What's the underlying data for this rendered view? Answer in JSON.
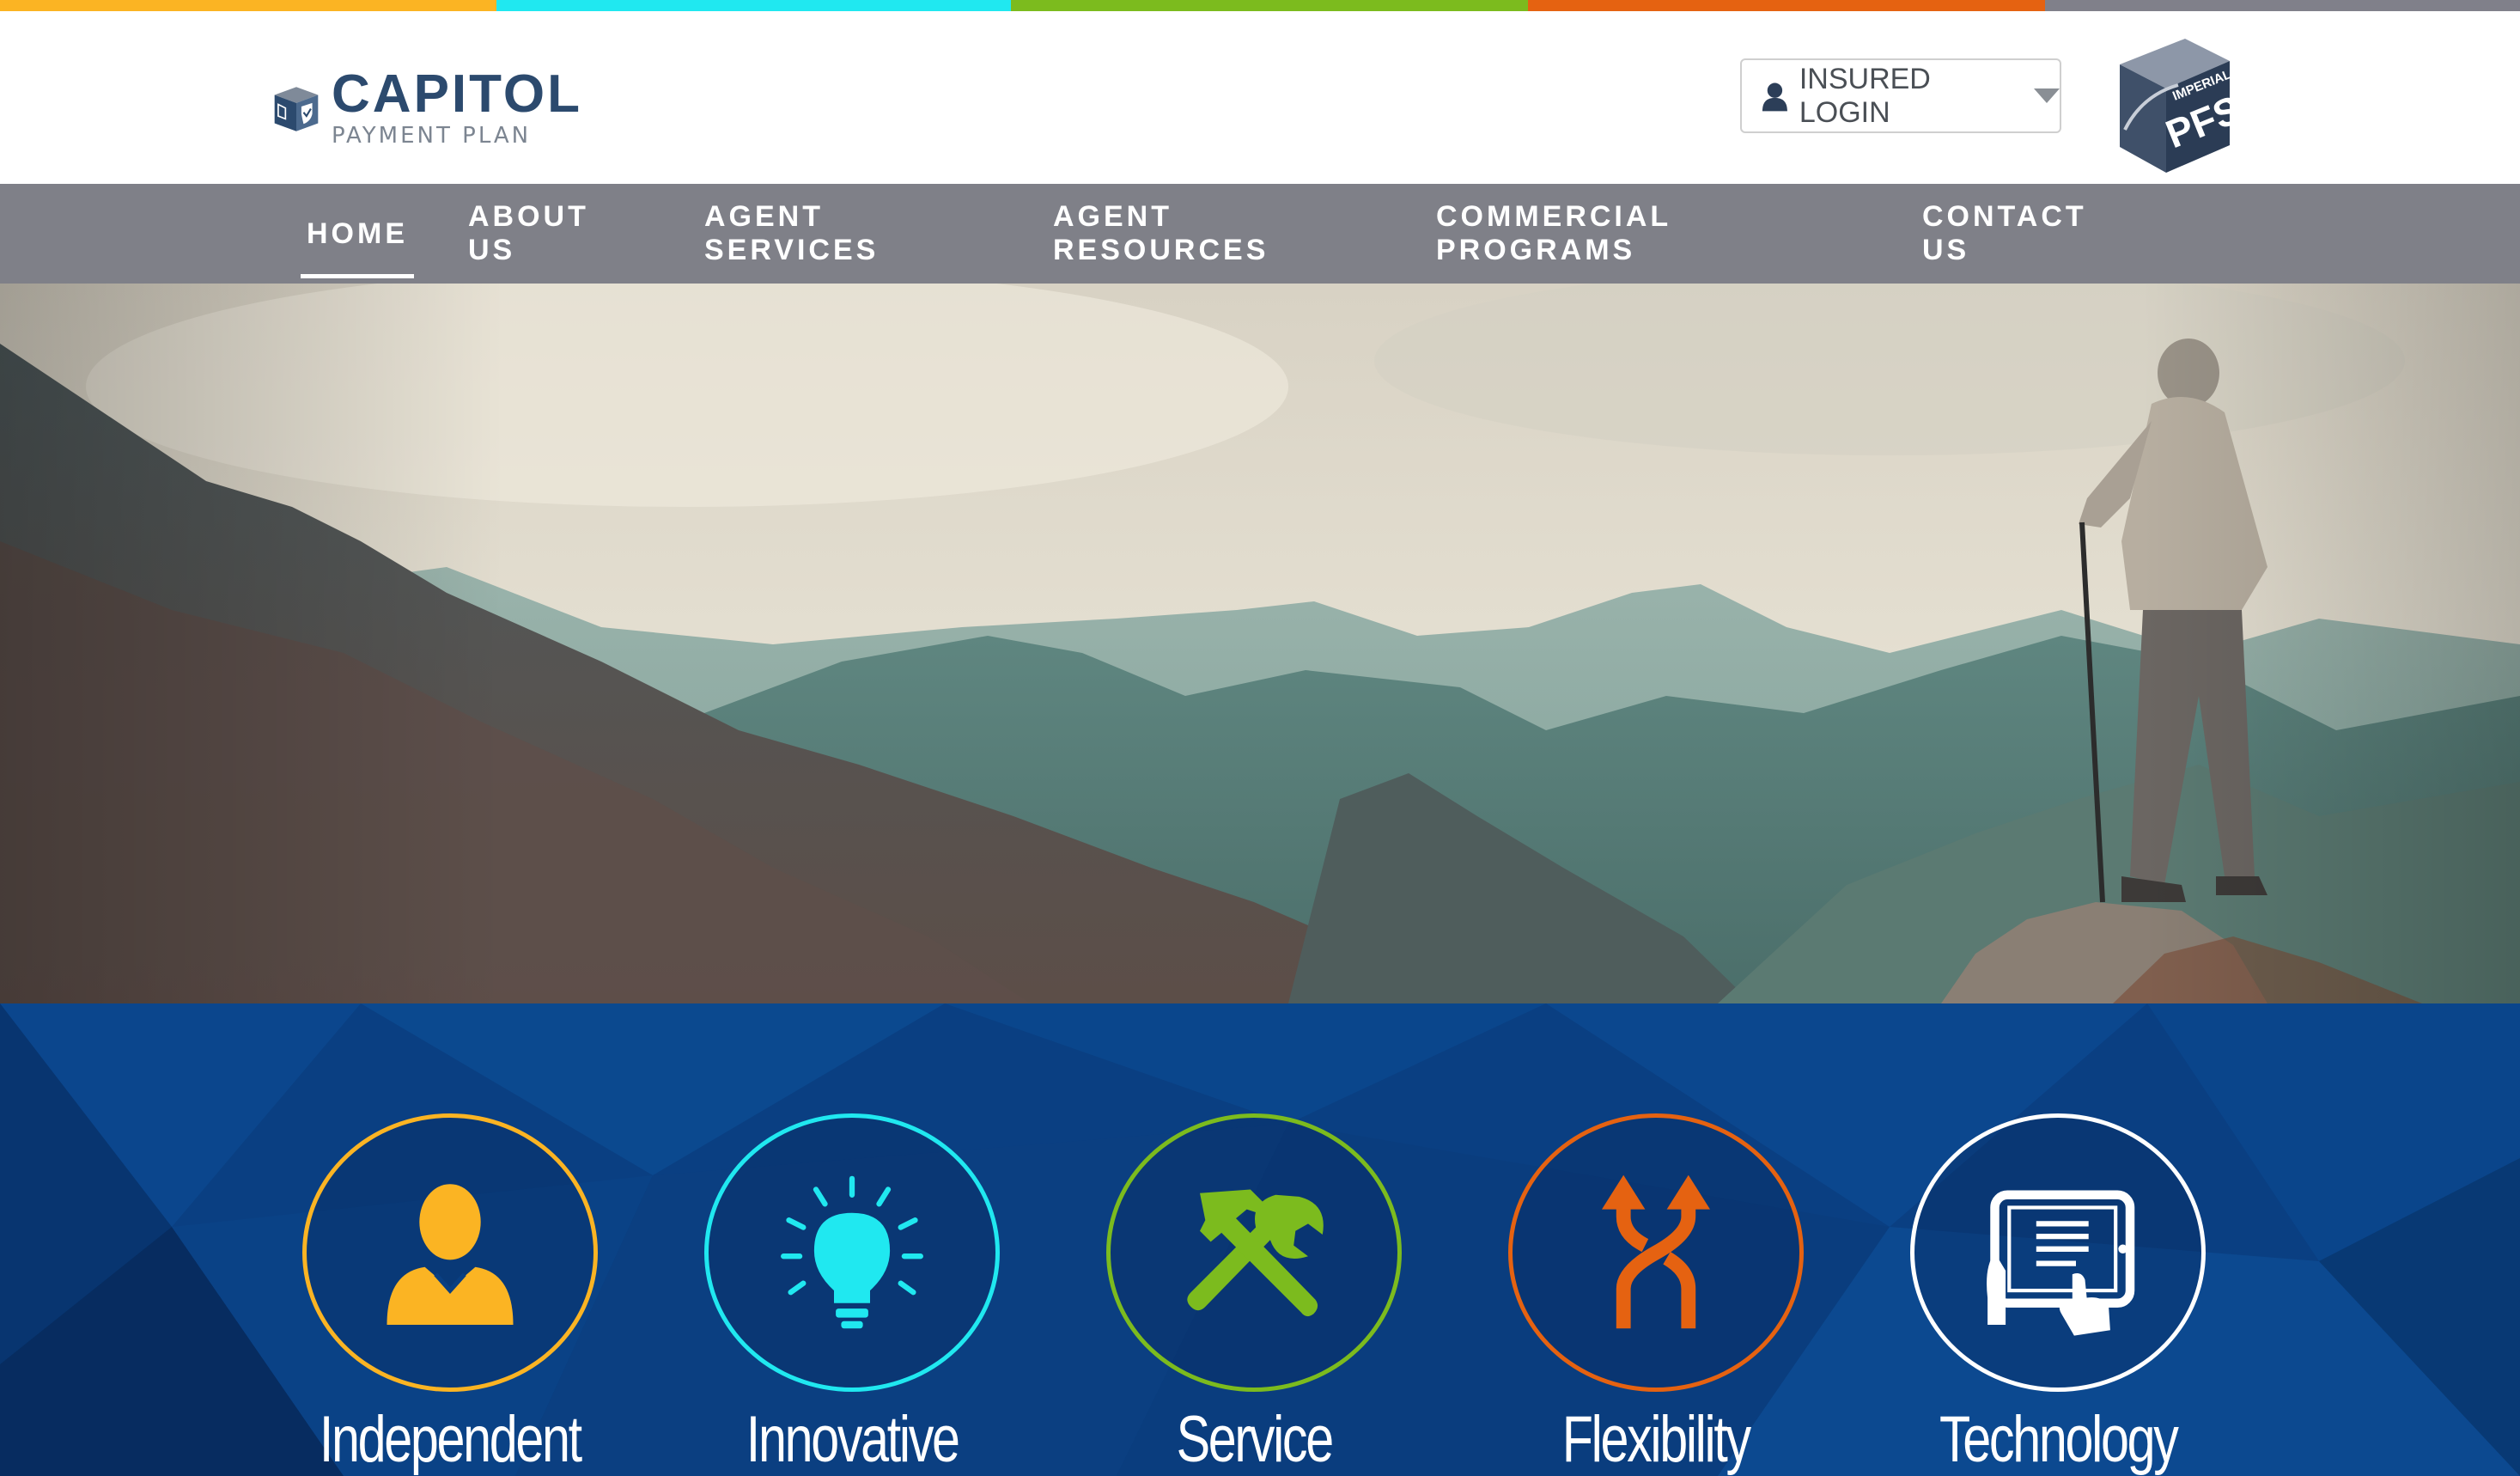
{
  "stripe_colors": [
    "#fbb423",
    "#20e8f0",
    "#7cbb1e",
    "#e56211",
    "#80808a"
  ],
  "header": {
    "logo_title": "CAPITOL",
    "logo_subtitle": "PAYMENT PLAN",
    "login_label": "INSURED LOGIN",
    "partner_logo": "IMPERIAL PFS",
    "partner_logo_small": "IMPERIAL",
    "partner_logo_big": "PFS"
  },
  "nav": {
    "items": [
      {
        "label": "HOME",
        "active": true
      },
      {
        "label": "ABOUT US"
      },
      {
        "label": "AGENT SERVICES"
      },
      {
        "label": "AGENT RESOURCES"
      },
      {
        "label": "COMMERCIAL PROGRAMS"
      },
      {
        "label": "CONTACT US"
      }
    ]
  },
  "hero": {
    "image": "mountain-hiker"
  },
  "features": [
    {
      "label": "Independent",
      "icon": "person-icon",
      "color": "#fbb423"
    },
    {
      "label": "Innovative",
      "icon": "lightbulb-icon",
      "color": "#20e8f0"
    },
    {
      "label": "Service",
      "icon": "tools-icon",
      "color": "#7cbb1e"
    },
    {
      "label": "Flexibility",
      "icon": "merge-arrows-icon",
      "color": "#e56211"
    },
    {
      "label": "Technology",
      "icon": "tablet-touch-icon",
      "color": "#ffffff"
    }
  ]
}
